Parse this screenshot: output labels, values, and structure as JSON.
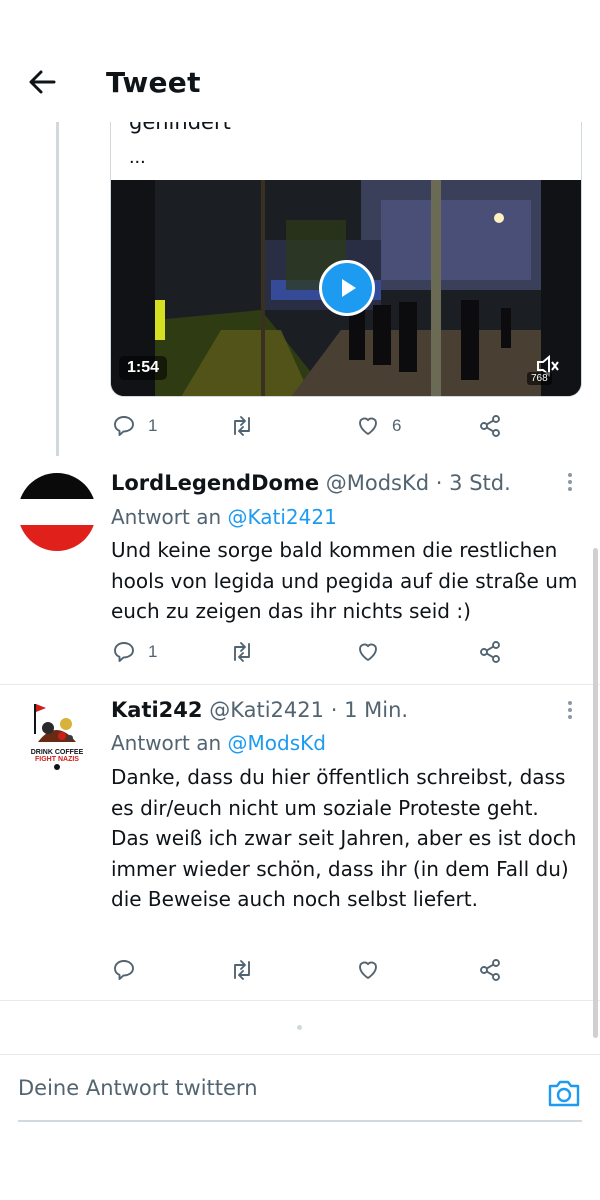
{
  "header": {
    "title": "Tweet"
  },
  "prev_tweet": {
    "quote_partial_text": "gehindert",
    "quote_ellipsis": "...",
    "video": {
      "duration": "1:54",
      "views": "768"
    },
    "actions": {
      "replies": "1",
      "retweets": "",
      "likes": "6"
    }
  },
  "tweets": [
    {
      "name": "LordLegendDome",
      "handle": "@ModsKd",
      "separator": "·",
      "time": "3 Std.",
      "reply_prefix": "Antwort an",
      "reply_to": "@Kati2421",
      "text": "Und keine sorge bald kommen die restlichen hools von legida und pegida auf die straße um euch zu zeigen das ihr nichts seid :)",
      "actions": {
        "replies": "1",
        "retweets": "",
        "likes": ""
      },
      "avatar": {
        "colors": [
          "#0a0a0a",
          "#ffffff",
          "#e0201b"
        ]
      }
    },
    {
      "name": "Kati242",
      "handle": "@Kati2421",
      "separator": "·",
      "time": "1 Min.",
      "reply_prefix": "Antwort an",
      "reply_to": "@ModsKd",
      "text": "Danke, dass du hier öffentlich schreibst, dass es dir/euch nicht um soziale Proteste geht. Das weiß ich zwar seit Jahren, aber es ist doch immer wieder schön, dass ihr (in dem Fall du) die Beweise auch noch selbst liefert.",
      "actions": {
        "replies": "",
        "retweets": "",
        "likes": ""
      },
      "avatar": {
        "line1": "DRINK COFFEE",
        "line2": "FIGHT NAZIS"
      }
    }
  ],
  "composer": {
    "placeholder": "Deine Antwort twittern"
  },
  "colors": {
    "accent": "#1d9bf0",
    "text": "#0f1419",
    "secondary": "#536471",
    "border": "#cfd9de"
  }
}
